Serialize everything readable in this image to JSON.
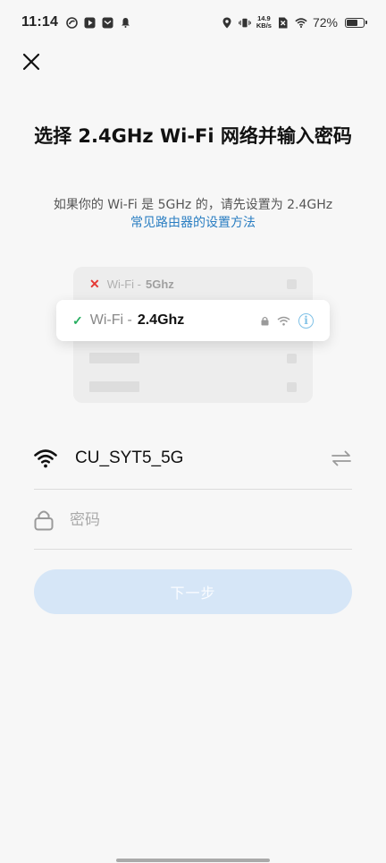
{
  "status_bar": {
    "time": "11:14",
    "net_speed_value": "14.9",
    "net_speed_unit": "KB/s",
    "battery_percent": "72%",
    "battery_level": 0.72
  },
  "title": "选择 2.4GHz Wi-Fi 网络并输入密码",
  "subtitle": "如果你的 Wi-Fi 是 5GHz 的，请先设置为 2.4GHz",
  "link": "常见路由器的设置方法",
  "illustration": {
    "row_5g_prefix": "Wi-Fi -",
    "row_5g_freq": "5Ghz",
    "row_24g_prefix": "Wi-Fi -",
    "row_24g_freq": "2.4Ghz",
    "info_glyph": "i"
  },
  "wifi_field": {
    "ssid": "CU_SYT5_5G"
  },
  "password_field": {
    "value": "",
    "placeholder": "密码"
  },
  "next_button": {
    "label": "下一步"
  },
  "colors": {
    "accent": "#2a7ec2",
    "button_disabled_bg": "#d6e6f7",
    "check_green": "#27ae60",
    "cross_red": "#e53935",
    "info_blue": "#7fc1e6"
  },
  "icons": [
    "close-icon",
    "wifi-icon",
    "swap-icon",
    "lock-icon",
    "check-icon",
    "cross-icon",
    "info-icon"
  ]
}
